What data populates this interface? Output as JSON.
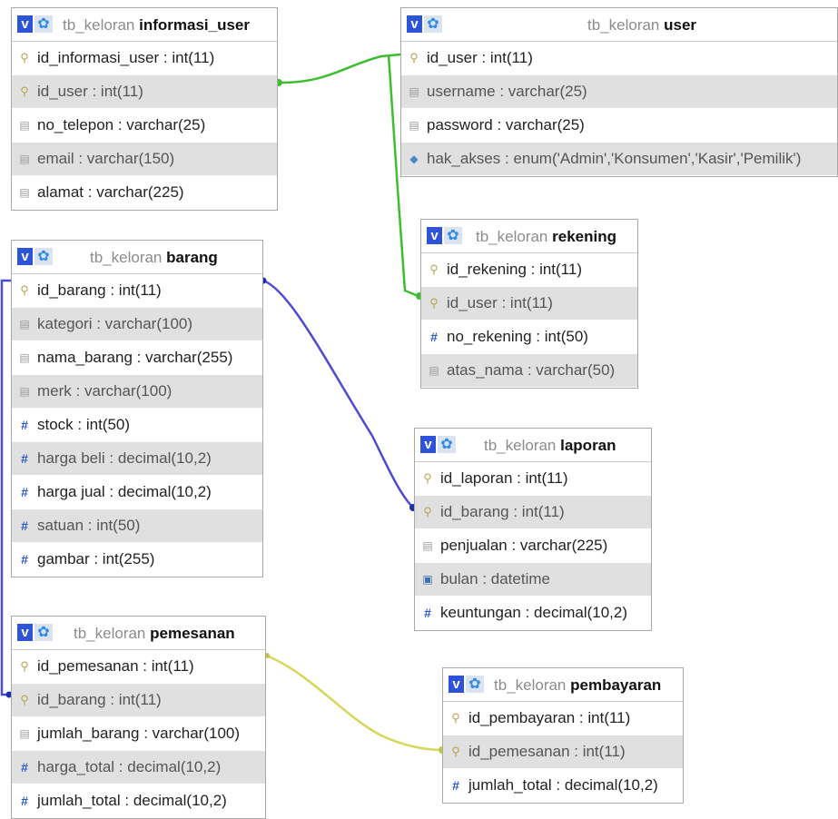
{
  "tables": [
    {
      "id": "informasi_user",
      "prefix": "tb_keloran",
      "name": "informasi_user",
      "columns": [
        {
          "label": "id_informasi_user : int(11)",
          "icon": "key-icon"
        },
        {
          "label": "id_user : int(11)",
          "icon": "key-icon"
        },
        {
          "label": "no_telepon : varchar(25)",
          "icon": "text-field-icon"
        },
        {
          "label": "email : varchar(150)",
          "icon": "text-field-icon"
        },
        {
          "label": "alamat : varchar(225)",
          "icon": "text-field-icon"
        }
      ]
    },
    {
      "id": "user",
      "prefix": "tb_keloran",
      "name": "user",
      "columns": [
        {
          "label": "id_user : int(11)",
          "icon": "key-icon"
        },
        {
          "label": "username : varchar(25)",
          "icon": "text-field-icon"
        },
        {
          "label": "password : varchar(25)",
          "icon": "text-field-icon"
        },
        {
          "label": "hak_akses : enum('Admin','Konsumen','Kasir','Pemilik')",
          "icon": "enum-icon"
        }
      ]
    },
    {
      "id": "rekening",
      "prefix": "tb_keloran",
      "name": "rekening",
      "columns": [
        {
          "label": "id_rekening : int(11)",
          "icon": "key-icon"
        },
        {
          "label": "id_user : int(11)",
          "icon": "key-icon"
        },
        {
          "label": "no_rekening : int(50)",
          "icon": "number-icon"
        },
        {
          "label": "atas_nama : varchar(50)",
          "icon": "text-field-icon"
        }
      ]
    },
    {
      "id": "barang",
      "prefix": "tb_keloran",
      "name": "barang",
      "columns": [
        {
          "label": "id_barang : int(11)",
          "icon": "key-icon"
        },
        {
          "label": "kategori : varchar(100)",
          "icon": "text-field-icon"
        },
        {
          "label": "nama_barang : varchar(255)",
          "icon": "text-field-icon"
        },
        {
          "label": "merk : varchar(100)",
          "icon": "text-field-icon"
        },
        {
          "label": "stock : int(50)",
          "icon": "number-icon"
        },
        {
          "label": "harga beli : decimal(10,2)",
          "icon": "number-icon"
        },
        {
          "label": "harga jual : decimal(10,2)",
          "icon": "number-icon"
        },
        {
          "label": "satuan : int(50)",
          "icon": "number-icon"
        },
        {
          "label": "gambar : int(255)",
          "icon": "number-icon"
        }
      ]
    },
    {
      "id": "laporan",
      "prefix": "tb_keloran",
      "name": "laporan",
      "columns": [
        {
          "label": "id_laporan : int(11)",
          "icon": "key-icon"
        },
        {
          "label": "id_barang : int(11)",
          "icon": "key-icon"
        },
        {
          "label": "penjualan : varchar(225)",
          "icon": "text-field-icon"
        },
        {
          "label": "bulan : datetime",
          "icon": "calendar-icon"
        },
        {
          "label": "keuntungan : decimal(10,2)",
          "icon": "number-icon"
        }
      ]
    },
    {
      "id": "pemesanan",
      "prefix": "tb_keloran",
      "name": "pemesanan",
      "columns": [
        {
          "label": "id_pemesanan : int(11)",
          "icon": "key-icon"
        },
        {
          "label": "id_barang : int(11)",
          "icon": "key-icon"
        },
        {
          "label": "jumlah_barang : varchar(100)",
          "icon": "text-field-icon"
        },
        {
          "label": "harga_total : decimal(10,2)",
          "icon": "number-icon"
        },
        {
          "label": "jumlah_total : decimal(10,2)",
          "icon": "number-icon"
        }
      ]
    },
    {
      "id": "pembayaran",
      "prefix": "tb_keloran",
      "name": "pembayaran",
      "columns": [
        {
          "label": "id_pembayaran : int(11)",
          "icon": "key-icon"
        },
        {
          "label": "id_pemesanan : int(11)",
          "icon": "key-icon"
        },
        {
          "label": "jumlah_total : decimal(10,2)",
          "icon": "number-icon"
        }
      ]
    }
  ],
  "relations": [
    {
      "from": "informasi_user.id_user",
      "to": "user.id_user",
      "color": "#3dbd2f"
    },
    {
      "from": "rekening.id_user",
      "to": "user.id_user",
      "color": "#3dbd2f"
    },
    {
      "from": "laporan.id_barang",
      "to": "barang.id_barang",
      "color": "#4b4bd4"
    },
    {
      "from": "pemesanan.id_barang",
      "to": "barang.id_barang",
      "color": "#4b4bd4"
    },
    {
      "from": "pembayaran.id_pemesanan",
      "to": "pemesanan.id_pemesanan",
      "color": "#d6d65a"
    }
  ],
  "header_icons": {
    "view": "v-icon",
    "options": "gear-icon"
  },
  "header_v_label": "v",
  "header_gear_glyph": "✿"
}
